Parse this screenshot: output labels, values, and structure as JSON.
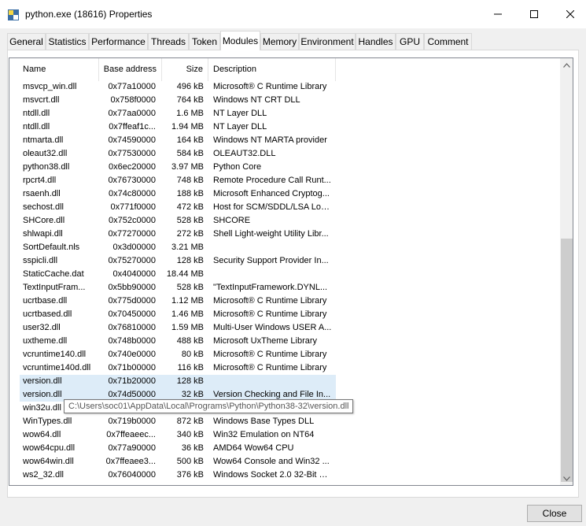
{
  "window": {
    "title": "python.exe (18616) Properties",
    "app_icon": "python-icon",
    "controls": {
      "minimize": "minimize-icon",
      "maximize": "maximize-icon",
      "close": "close-icon"
    }
  },
  "tabs": [
    {
      "label": "General"
    },
    {
      "label": "Statistics"
    },
    {
      "label": "Performance"
    },
    {
      "label": "Threads"
    },
    {
      "label": "Token"
    },
    {
      "label": "Modules",
      "active": true
    },
    {
      "label": "Memory"
    },
    {
      "label": "Environment"
    },
    {
      "label": "Handles"
    },
    {
      "label": "GPU"
    },
    {
      "label": "Comment"
    }
  ],
  "modules": {
    "columns": [
      "Name",
      "Base address",
      "Size",
      "Description"
    ],
    "rows": [
      {
        "name": "msvcp_win.dll",
        "base": "0x77a10000",
        "size": "496 kB",
        "desc": "Microsoft® C Runtime Library"
      },
      {
        "name": "msvcrt.dll",
        "base": "0x758f0000",
        "size": "764 kB",
        "desc": "Windows NT CRT DLL"
      },
      {
        "name": "ntdll.dll",
        "base": "0x77aa0000",
        "size": "1.6 MB",
        "desc": "NT Layer DLL"
      },
      {
        "name": "ntdll.dll",
        "base": "0x7ffeaf1c...",
        "size": "1.94 MB",
        "desc": "NT Layer DLL"
      },
      {
        "name": "ntmarta.dll",
        "base": "0x74590000",
        "size": "164 kB",
        "desc": "Windows NT MARTA provider"
      },
      {
        "name": "oleaut32.dll",
        "base": "0x77530000",
        "size": "584 kB",
        "desc": "OLEAUT32.DLL"
      },
      {
        "name": "python38.dll",
        "base": "0x6ec20000",
        "size": "3.97 MB",
        "desc": "Python Core"
      },
      {
        "name": "rpcrt4.dll",
        "base": "0x76730000",
        "size": "748 kB",
        "desc": "Remote Procedure Call Runt..."
      },
      {
        "name": "rsaenh.dll",
        "base": "0x74c80000",
        "size": "188 kB",
        "desc": "Microsoft Enhanced Cryptog..."
      },
      {
        "name": "sechost.dll",
        "base": "0x771f0000",
        "size": "472 kB",
        "desc": "Host for SCM/SDDL/LSA Loo..."
      },
      {
        "name": "SHCore.dll",
        "base": "0x752c0000",
        "size": "528 kB",
        "desc": "SHCORE"
      },
      {
        "name": "shlwapi.dll",
        "base": "0x77270000",
        "size": "272 kB",
        "desc": "Shell Light-weight Utility Libr..."
      },
      {
        "name": "SortDefault.nls",
        "base": "0x3d00000",
        "size": "3.21 MB",
        "desc": ""
      },
      {
        "name": "sspicli.dll",
        "base": "0x75270000",
        "size": "128 kB",
        "desc": "Security Support Provider In..."
      },
      {
        "name": "StaticCache.dat",
        "base": "0x4040000",
        "size": "18.44 MB",
        "desc": ""
      },
      {
        "name": "TextInputFram...",
        "base": "0x5bb90000",
        "size": "528 kB",
        "desc": "\"TextInputFramework.DYNL..."
      },
      {
        "name": "ucrtbase.dll",
        "base": "0x775d0000",
        "size": "1.12 MB",
        "desc": "Microsoft® C Runtime Library"
      },
      {
        "name": "ucrtbased.dll",
        "base": "0x70450000",
        "size": "1.46 MB",
        "desc": "Microsoft® C Runtime Library"
      },
      {
        "name": "user32.dll",
        "base": "0x76810000",
        "size": "1.59 MB",
        "desc": "Multi-User Windows USER A..."
      },
      {
        "name": "uxtheme.dll",
        "base": "0x748b0000",
        "size": "488 kB",
        "desc": "Microsoft UxTheme Library"
      },
      {
        "name": "vcruntime140.dll",
        "base": "0x740e0000",
        "size": "80 kB",
        "desc": "Microsoft® C Runtime Library"
      },
      {
        "name": "vcruntime140d.dll",
        "base": "0x71b00000",
        "size": "116 kB",
        "desc": "Microsoft® C Runtime Library"
      },
      {
        "name": "version.dll",
        "base": "0x71b20000",
        "size": "128 kB",
        "desc": "",
        "highlight": true
      },
      {
        "name": "version.dll",
        "base": "0x74d50000",
        "size": "32 kB",
        "desc": "Version Checking and File In...",
        "highlight": true
      },
      {
        "name": "win32u.dll",
        "base": "",
        "size": "",
        "desc": ""
      },
      {
        "name": "WinTypes.dll",
        "base": "0x719b0000",
        "size": "872 kB",
        "desc": "Windows Base Types DLL"
      },
      {
        "name": "wow64.dll",
        "base": "0x7ffeaeec...",
        "size": "340 kB",
        "desc": "Win32 Emulation on NT64"
      },
      {
        "name": "wow64cpu.dll",
        "base": "0x77a90000",
        "size": "36 kB",
        "desc": "AMD64 Wow64 CPU"
      },
      {
        "name": "wow64win.dll",
        "base": "0x7ffeaee3...",
        "size": "500 kB",
        "desc": "Wow64 Console and Win32 ..."
      },
      {
        "name": "ws2_32.dll",
        "base": "0x76040000",
        "size": "376 kB",
        "desc": "Windows Socket 2.0 32-Bit DLL"
      }
    ]
  },
  "tooltip": "C:\\Users\\soc01\\AppData\\Local\\Programs\\Python\\Python38-32\\version.dll",
  "scrollbar": {
    "up": "scroll-up-arrow-icon",
    "down": "scroll-down-arrow-icon"
  },
  "footer": {
    "close_label": "Close"
  },
  "colors": {
    "selection": "#ddecf8",
    "panel_border": "#d9d9d9",
    "thumb": "#cdcdcd"
  }
}
